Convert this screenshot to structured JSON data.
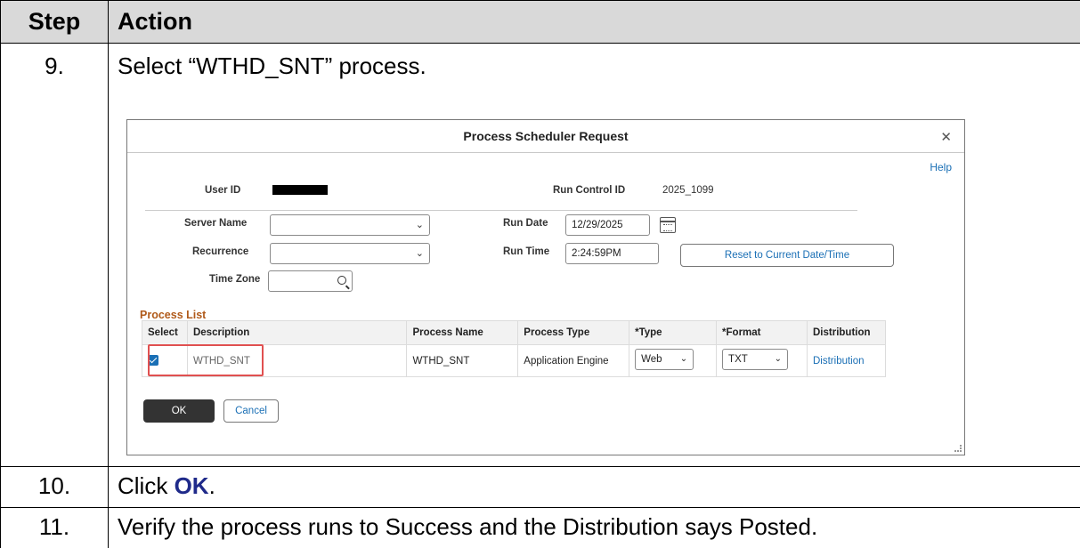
{
  "table": {
    "header": {
      "step": "Step",
      "action": "Action"
    },
    "rows": [
      {
        "step": "9.",
        "action": "Select “WTHD_SNT” process."
      },
      {
        "step": "10.",
        "action_prefix": "Click ",
        "action_bold": "OK",
        "action_suffix": "."
      },
      {
        "step": "11.",
        "action": "Verify the process runs to Success and the Distribution says Posted."
      }
    ]
  },
  "dialog": {
    "title": "Process Scheduler Request",
    "close_icon": "close-icon",
    "help": "Help",
    "user_id_label": "User ID",
    "run_control_label": "Run Control ID",
    "run_control_value": "2025_1099",
    "server_name_label": "Server Name",
    "server_name_value": "",
    "recurrence_label": "Recurrence",
    "recurrence_value": "",
    "time_zone_label": "Time Zone",
    "time_zone_value": "",
    "run_date_label": "Run Date",
    "run_date_value": "12/29/2025",
    "run_time_label": "Run Time",
    "run_time_value": "2:24:59PM",
    "reset_button": "Reset to Current Date/Time",
    "process_list_title": "Process List",
    "columns": [
      "Select",
      "Description",
      "Process Name",
      "Process Type",
      "*Type",
      "*Format",
      "Distribution"
    ],
    "process_row": {
      "selected": true,
      "description": "WTHD_SNT",
      "process_name": "WTHD_SNT",
      "process_type": "Application Engine",
      "type": "Web",
      "format": "TXT",
      "distribution": "Distribution"
    },
    "ok_button": "OK",
    "cancel_button": "Cancel",
    "highlight_color": "#e05050",
    "link_color": "#1a6fb5"
  }
}
